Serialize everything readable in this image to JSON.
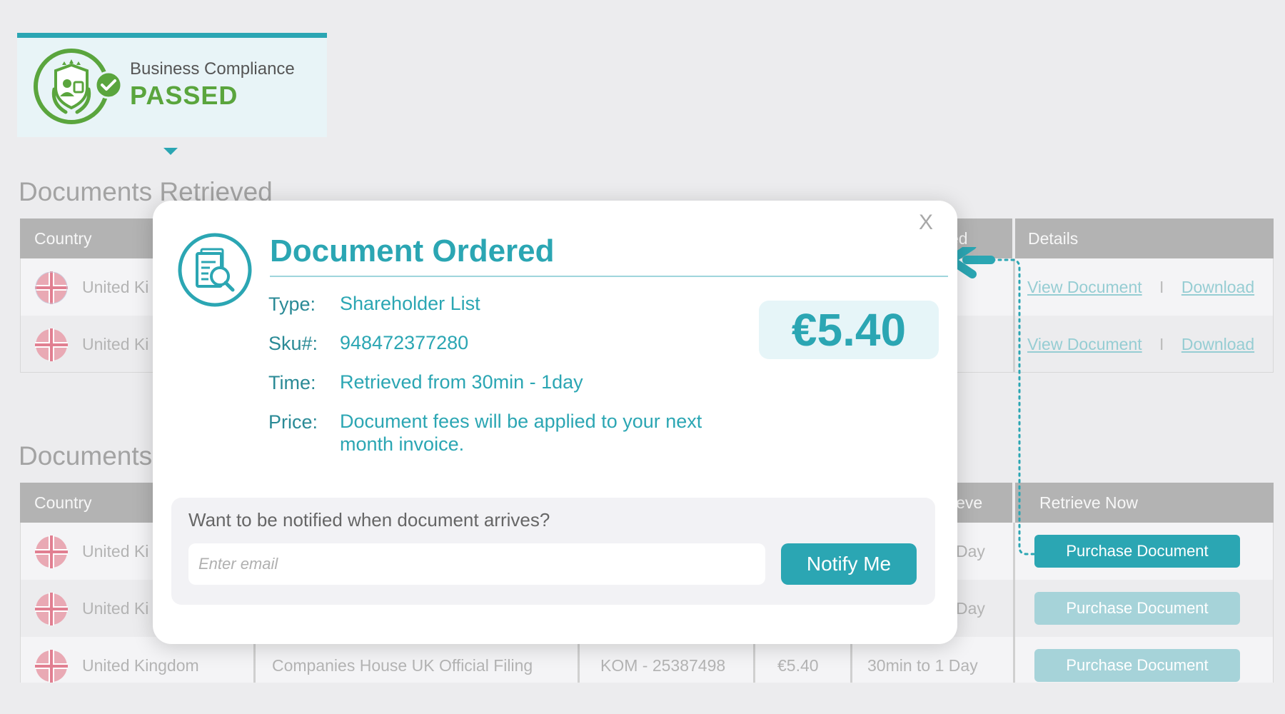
{
  "badge": {
    "title": "Business Compliance",
    "status": "PASSED",
    "status_color": "#5aa53d",
    "emblem_icon": "shield-laurel-icon",
    "check_icon": "check-circle-icon"
  },
  "retrieved": {
    "title": "Documents Retrieved",
    "headers": {
      "country": "Country",
      "retrieved": "ed",
      "details": "Details"
    },
    "rows": [
      {
        "country": "United Ki",
        "view": "View Document",
        "sep": "I",
        "download": "Download"
      },
      {
        "country": "United Ki",
        "view": "View Document",
        "sep": "I",
        "download": "Download"
      }
    ]
  },
  "available": {
    "title": "Documents",
    "headers": {
      "country": "Country",
      "retrieve": "ieve",
      "retrieve_now": "Retrieve Now"
    },
    "rows": [
      {
        "country": "United Ki",
        "time": "Day",
        "action": "Purchase Document",
        "active": true
      },
      {
        "country": "United Ki",
        "time": "Day",
        "action": "Purchase Document",
        "active": false
      },
      {
        "country": "United Kingdom",
        "source": "Companies House UK Official Filing",
        "code": "KOM - 25387498",
        "price": "€5.40",
        "time": "30min to 1 Day",
        "action": "Purchase Document",
        "active": false
      }
    ]
  },
  "modal": {
    "close": "X",
    "title": "Document Ordered",
    "icon": "document-search-icon",
    "fields": {
      "type_label": "Type:",
      "type_value": "Shareholder List",
      "sku_label": "Sku#:",
      "sku_value": "948472377280",
      "time_label": "Time:",
      "time_value": "Retrieved from 30min - 1day",
      "price_label": "Price:",
      "price_value": "Document fees will be applied to your next month invoice."
    },
    "price": "€5.40",
    "notify": {
      "prompt": "Want to be notified when document arrives?",
      "placeholder": "Enter email",
      "button": "Notify Me"
    }
  },
  "colors": {
    "accent": "#2ba6b3",
    "success": "#5aa53d"
  }
}
